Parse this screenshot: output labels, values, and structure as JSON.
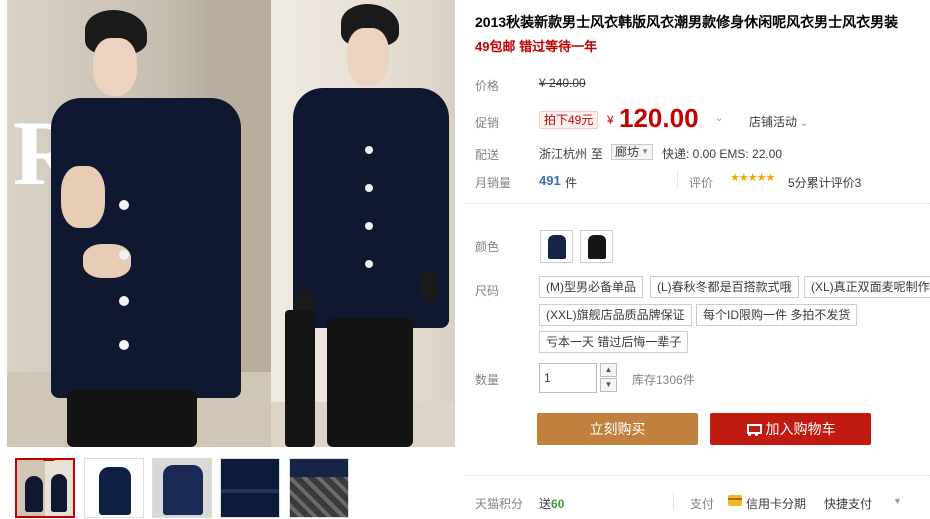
{
  "product": {
    "title": "2013秋装新款男士风衣韩版风衣潮男款修身休闲呢风衣男士风衣男装",
    "subtitle": "49包邮 错过等待一年"
  },
  "price": {
    "label": "价格",
    "currency": "¥",
    "original": "240.00",
    "promo_label": "促销",
    "promo_tag": "拍下49元",
    "current": "120.00",
    "shop_activity": "店铺活动"
  },
  "shipping": {
    "label": "配送",
    "from": "浙江杭州",
    "to_word": "至",
    "destination": "廊坊",
    "fee": "快递: 0.00 EMS: 22.00"
  },
  "sales": {
    "label": "月销量",
    "count": "491",
    "unit": "件",
    "rating_label": "评价",
    "stars": "★★★★★",
    "rating_text": "5分累计评价3"
  },
  "color": {
    "label": "颜色",
    "options": [
      {
        "name": "navy-coat",
        "color": "#152447"
      },
      {
        "name": "black-coat",
        "color": "#151515"
      }
    ]
  },
  "size": {
    "label": "尺码",
    "options": [
      "(M)型男必备单品",
      "(L)春秋冬都是百搭款式哦",
      "(XL)真正双面麦呢制作",
      "(XXL)旗舰店品质品牌保证",
      "每个ID限购一件 多拍不发货",
      "亏本一天 错过后悔一辈子"
    ]
  },
  "quantity": {
    "label": "数量",
    "value": "1",
    "up": "▲",
    "down": "▼",
    "stock": "库存1306件"
  },
  "actions": {
    "buy_now": "立刻购买",
    "add_cart": "加入购物车"
  },
  "points": {
    "label": "天猫积分",
    "prefix": "送",
    "value": "60"
  },
  "payment": {
    "label": "支付",
    "method1": "信用卡分期",
    "method2": "快捷支付"
  },
  "colors": {
    "accent_red": "#c40000",
    "buy_now_bg": "#c1803e",
    "add_cart_bg": "#c11a10",
    "link_blue": "#3d6fb5",
    "star_gold": "#f0a800"
  }
}
